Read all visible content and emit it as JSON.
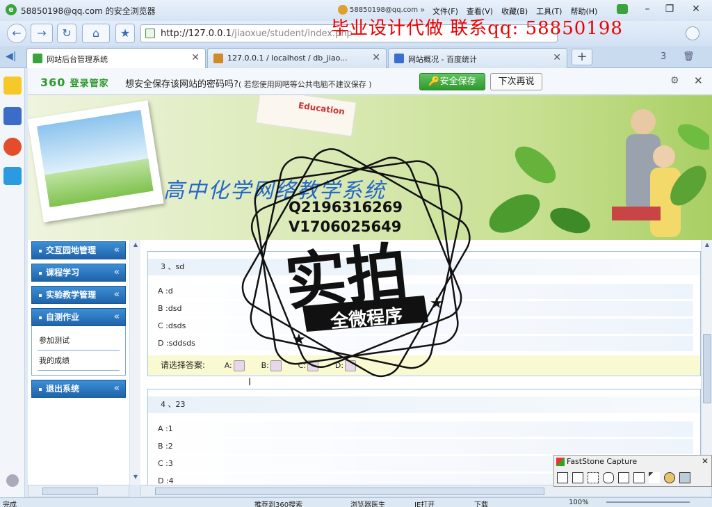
{
  "window": {
    "title": "58850198@qq.com 的安全浏览器",
    "user": "58850198@qq.com",
    "more": "»",
    "menu": [
      "文件(F)",
      "查看(V)",
      "收藏(B)",
      "工具(T)",
      "帮助(H)"
    ],
    "controls": {
      "min": "–",
      "max": "❐",
      "close": "✕"
    }
  },
  "address": {
    "url_host": "http://127.0.0.1",
    "url_path": "/jiaoxue/student/index.php",
    "overlay_ad": "毕业设计代做  联系qq: 58850198"
  },
  "tabs": [
    {
      "label": "网站后台管理系统",
      "active": true
    },
    {
      "label": "127.0.0.1 / localhost / db_jiao...",
      "active": false
    },
    {
      "label": "网站概况 - 百度统计",
      "active": false
    }
  ],
  "tab_counter": "3",
  "password_bar": {
    "brand": "360",
    "brand_suffix": "登录管家",
    "message": "想安全保存该网站的密码吗?",
    "note": "( 若您使用网吧等公共电脑不建议保存 )",
    "save_label": "安全保存",
    "later_label": "下次再说"
  },
  "banner": {
    "title": "高中化学网络教学系统",
    "card_text": "Education"
  },
  "nav": {
    "items": [
      {
        "label": "交互园地管理",
        "chev": "«"
      },
      {
        "label": "课程学习",
        "chev": "«"
      },
      {
        "label": "实验教学管理",
        "chev": "«"
      },
      {
        "label": "自测作业",
        "chev": "«",
        "sub": [
          "参加测试",
          "我的成绩"
        ]
      },
      {
        "label": "退出系统",
        "chev": "«"
      }
    ]
  },
  "questions": [
    {
      "title": "3 、sd",
      "options": [
        "A :d",
        "B :dsd",
        "C :dsds",
        "D :sddsds"
      ],
      "answer_prompt": "请选择答案:",
      "answer_labels": [
        "A:",
        "B:",
        "C:",
        "D:"
      ]
    },
    {
      "title": "4 、23",
      "options": [
        "A :1",
        "B :2",
        "C :3",
        "D :4"
      ]
    }
  ],
  "stamp": {
    "line1": "Q2196316269",
    "line2": "V1706025649",
    "main": "实拍",
    "ribbon": "全微程序"
  },
  "faststone": {
    "title": "FastStone Capture",
    "close": "✕"
  },
  "statusbar": {
    "left": "完成",
    "items": [
      "推荐到360搜索",
      "浏览器医生",
      "IE打开",
      "下载",
      "100%"
    ]
  }
}
